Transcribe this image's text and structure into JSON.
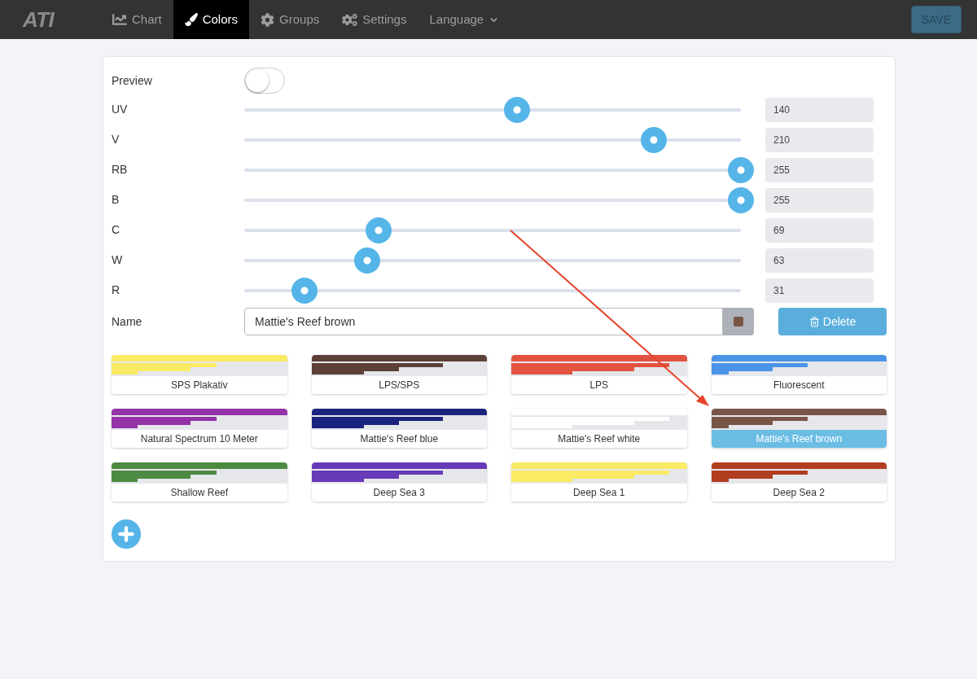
{
  "nav": {
    "logo": "ATI",
    "items": [
      {
        "label": "Chart",
        "kind": "chart",
        "selected": false
      },
      {
        "label": "Colors",
        "kind": "brush",
        "selected": true
      },
      {
        "label": "Groups",
        "kind": "gear",
        "selected": false
      },
      {
        "label": "Settings",
        "kind": "gears",
        "selected": false
      },
      {
        "label": "Language",
        "kind": "dropdown",
        "selected": false
      }
    ],
    "save": "SAVE"
  },
  "preview": {
    "label": "Preview",
    "on": false
  },
  "channels": [
    {
      "name": "UV",
      "level": 0.549,
      "value": "140"
    },
    {
      "name": "V",
      "level": 0.824,
      "value": "210"
    },
    {
      "name": "RB",
      "level": 1,
      "value": "255"
    },
    {
      "name": "B",
      "level": 1,
      "value": "255"
    },
    {
      "name": "C",
      "level": 0.271,
      "value": "69"
    },
    {
      "name": "W",
      "level": 0.247,
      "value": "63"
    },
    {
      "name": "R",
      "level": 0.122,
      "value": "31"
    }
  ],
  "name_field": {
    "label": "Name",
    "value": "Mattie's Reef brown",
    "color": "#795548"
  },
  "delete": "Delete",
  "presets": [
    {
      "name": "SPS Plakativ",
      "color": "#fbea63",
      "selected": false
    },
    {
      "name": "LPS/SPS",
      "color": "#5d4037",
      "selected": false
    },
    {
      "name": "LPS",
      "color": "#e35340",
      "selected": false
    },
    {
      "name": "Fluorescent",
      "color": "#4a94e8",
      "selected": false
    },
    {
      "name": "Natural Spectrum 10 Meter",
      "color": "#9432a8",
      "selected": false
    },
    {
      "name": "Mattie's Reef blue",
      "color": "#1a237e",
      "selected": false
    },
    {
      "name": "Mattie's Reef white",
      "color": "#ffffff",
      "selected": false
    },
    {
      "name": "Mattie's Reef brown",
      "color": "#795548",
      "selected": true
    },
    {
      "name": "Shallow Reef",
      "color": "#4e8b42",
      "selected": false
    },
    {
      "name": "Deep Sea 3",
      "color": "#673ab7",
      "selected": false
    },
    {
      "name": "Deep Sea 1",
      "color": "#fbea63",
      "selected": false
    },
    {
      "name": "Deep Sea 2",
      "color": "#b23e20",
      "selected": false
    }
  ]
}
